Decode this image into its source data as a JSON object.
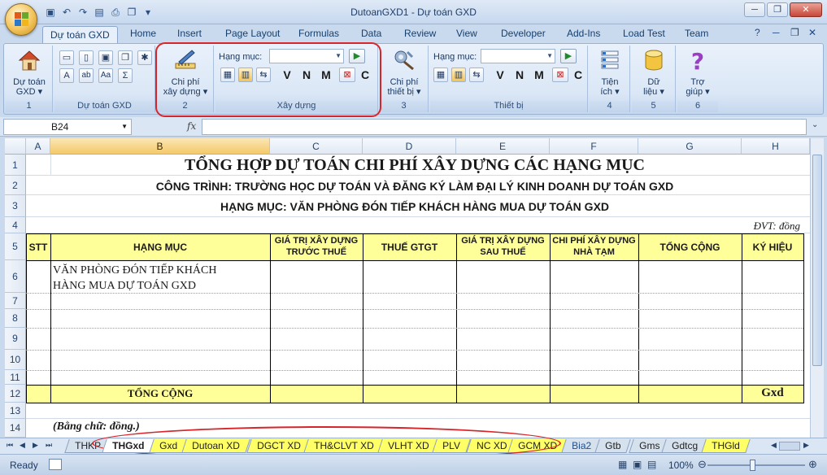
{
  "window": {
    "title": "DutoanGXD1 - Dự toán GXD",
    "min": "─",
    "restore": "❐",
    "close": "✕"
  },
  "ribbon_tabs": [
    "Dự toán GXD",
    "Home",
    "Insert",
    "Page Layout",
    "Formulas",
    "Data",
    "Review",
    "View",
    "Developer",
    "Add-Ins",
    "Load Test",
    "Team"
  ],
  "ribbon": {
    "dutoan_btn": [
      "Dự toán",
      "GXD ▾"
    ],
    "group1_label": "Dự toán GXD",
    "group1_num": "1",
    "chiphi_btn": [
      "Chi phí",
      "xây dựng ▾"
    ],
    "group2_num": "2",
    "hang_muc_label": "Hạng mục:",
    "xaydung_label": "Xây dựng",
    "chiphi_thietbi_btn": [
      "Chi phí",
      "thiết bị ▾"
    ],
    "group3_num": "3",
    "hang_muc_label2": "Hạng mục:",
    "thietbi_label": "Thiết bị",
    "tienich_btn": [
      "Tiện",
      "ích ▾"
    ],
    "group4_num": "4",
    "dulieu_btn": [
      "Dữ",
      "liệu ▾"
    ],
    "group5_num": "5",
    "trogiup_btn": [
      "Trợ",
      "giúp ▾"
    ],
    "group6_num": "6",
    "letters": [
      "V",
      "N",
      "M",
      "C"
    ],
    "small_letters": [
      "A",
      "Aa"
    ]
  },
  "formula_bar": {
    "name_box": "B24",
    "fx": "fx",
    "value": ""
  },
  "columns": [
    "A",
    "B",
    "C",
    "D",
    "E",
    "F",
    "G",
    "H"
  ],
  "rows": [
    "1",
    "2",
    "3",
    "4",
    "5",
    "6",
    "7",
    "8",
    "9",
    "10",
    "11",
    "12",
    "13",
    "14"
  ],
  "sheet": {
    "title": "TỔNG HỢP DỰ TOÁN CHI PHÍ XÂY DỰNG CÁC HẠNG MỤC",
    "cong_trinh": "CÔNG TRÌNH: TRƯỜNG HỌC DỰ TOÁN VÀ ĐĂNG KÝ LÀM ĐẠI LÝ KINH DOANH DỰ TOÁN GXD",
    "hang_muc": "HẠNG MỤC: VĂN PHÒNG ĐÓN TIẾP KHÁCH HÀNG MUA DỰ TOÁN GXD",
    "unit": "ĐVT: đồng",
    "headers": {
      "stt": "STT",
      "hang_muc": "HẠNG MỤC",
      "gtxd_truoc": [
        "GIÁ TRỊ XÂY DỰNG",
        "TRƯỚC THUẾ"
      ],
      "thue": "THUẾ GTGT",
      "gtxd_sau": [
        "GIÁ TRỊ XÂY DỰNG",
        "SAU THUẾ"
      ],
      "chiphi_nhatam": [
        "CHI PHÍ XÂY DỰNG",
        "NHÀ TẠM"
      ],
      "tong_cong": "TỔNG CỘNG",
      "ky_hieu": "KÝ HIỆU"
    },
    "row6_item": [
      "VĂN   PHÒNG   ĐÓN   TIẾP   KHÁCH",
      "HÀNG MUA DỰ TOÁN GXD"
    ],
    "total_label": "TỔNG CỘNG",
    "total_symbol": "Gxd",
    "bang_chu": "(Bằng chữ:  đồng.)"
  },
  "sheet_tabs": [
    {
      "label": "THKP",
      "style": "gray"
    },
    {
      "label": "THGxd",
      "style": "active"
    },
    {
      "label": "Gxd",
      "style": "yellow"
    },
    {
      "label": "Dutoan XD",
      "style": "yellow"
    },
    {
      "label": "DGCT XD",
      "style": "yellow"
    },
    {
      "label": "TH&CLVT XD",
      "style": "yellow"
    },
    {
      "label": "VLHT XD",
      "style": "yellow"
    },
    {
      "label": "PLV",
      "style": "yellow"
    },
    {
      "label": "NC XD",
      "style": "yellow"
    },
    {
      "label": "GCM XD",
      "style": "yellow"
    },
    {
      "label": "Bia2",
      "style": "blue"
    },
    {
      "label": "Gtb",
      "style": "gray"
    },
    {
      "label": "Gms",
      "style": "gray"
    },
    {
      "label": "Gdtcg",
      "style": "gray"
    },
    {
      "label": "THGld",
      "style": "yellow"
    }
  ],
  "status": {
    "ready": "Ready",
    "zoom": "100%"
  },
  "colors": {
    "highlight_red": "#d7262b",
    "header_yellow": "#ffff99"
  }
}
